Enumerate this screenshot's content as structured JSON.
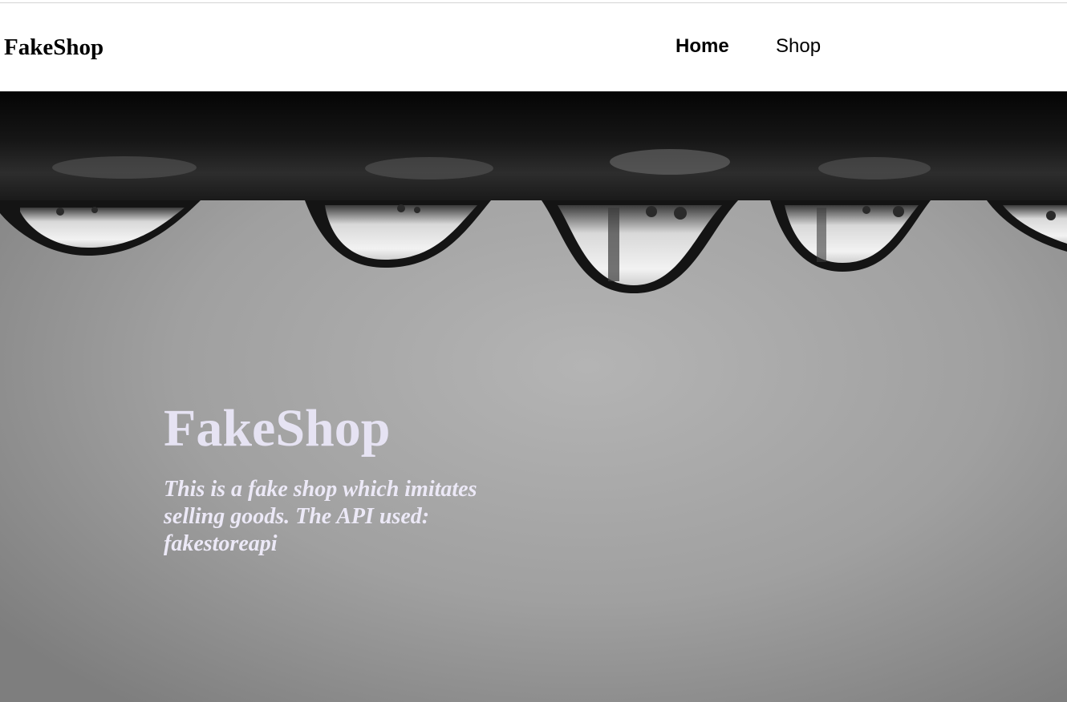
{
  "header": {
    "brand": "FakeShop",
    "nav": [
      {
        "label": "Home",
        "active": true
      },
      {
        "label": "Shop",
        "active": false
      }
    ]
  },
  "hero": {
    "title": "FakeShop",
    "subtitle": "This is a fake shop which imitates selling goods. The API used: fakestoreapi",
    "image": "water-droplets-on-pipe-photo"
  },
  "colors": {
    "hero_text": "#e6e3f3",
    "nav_text": "#000000",
    "background": "#ffffff"
  }
}
